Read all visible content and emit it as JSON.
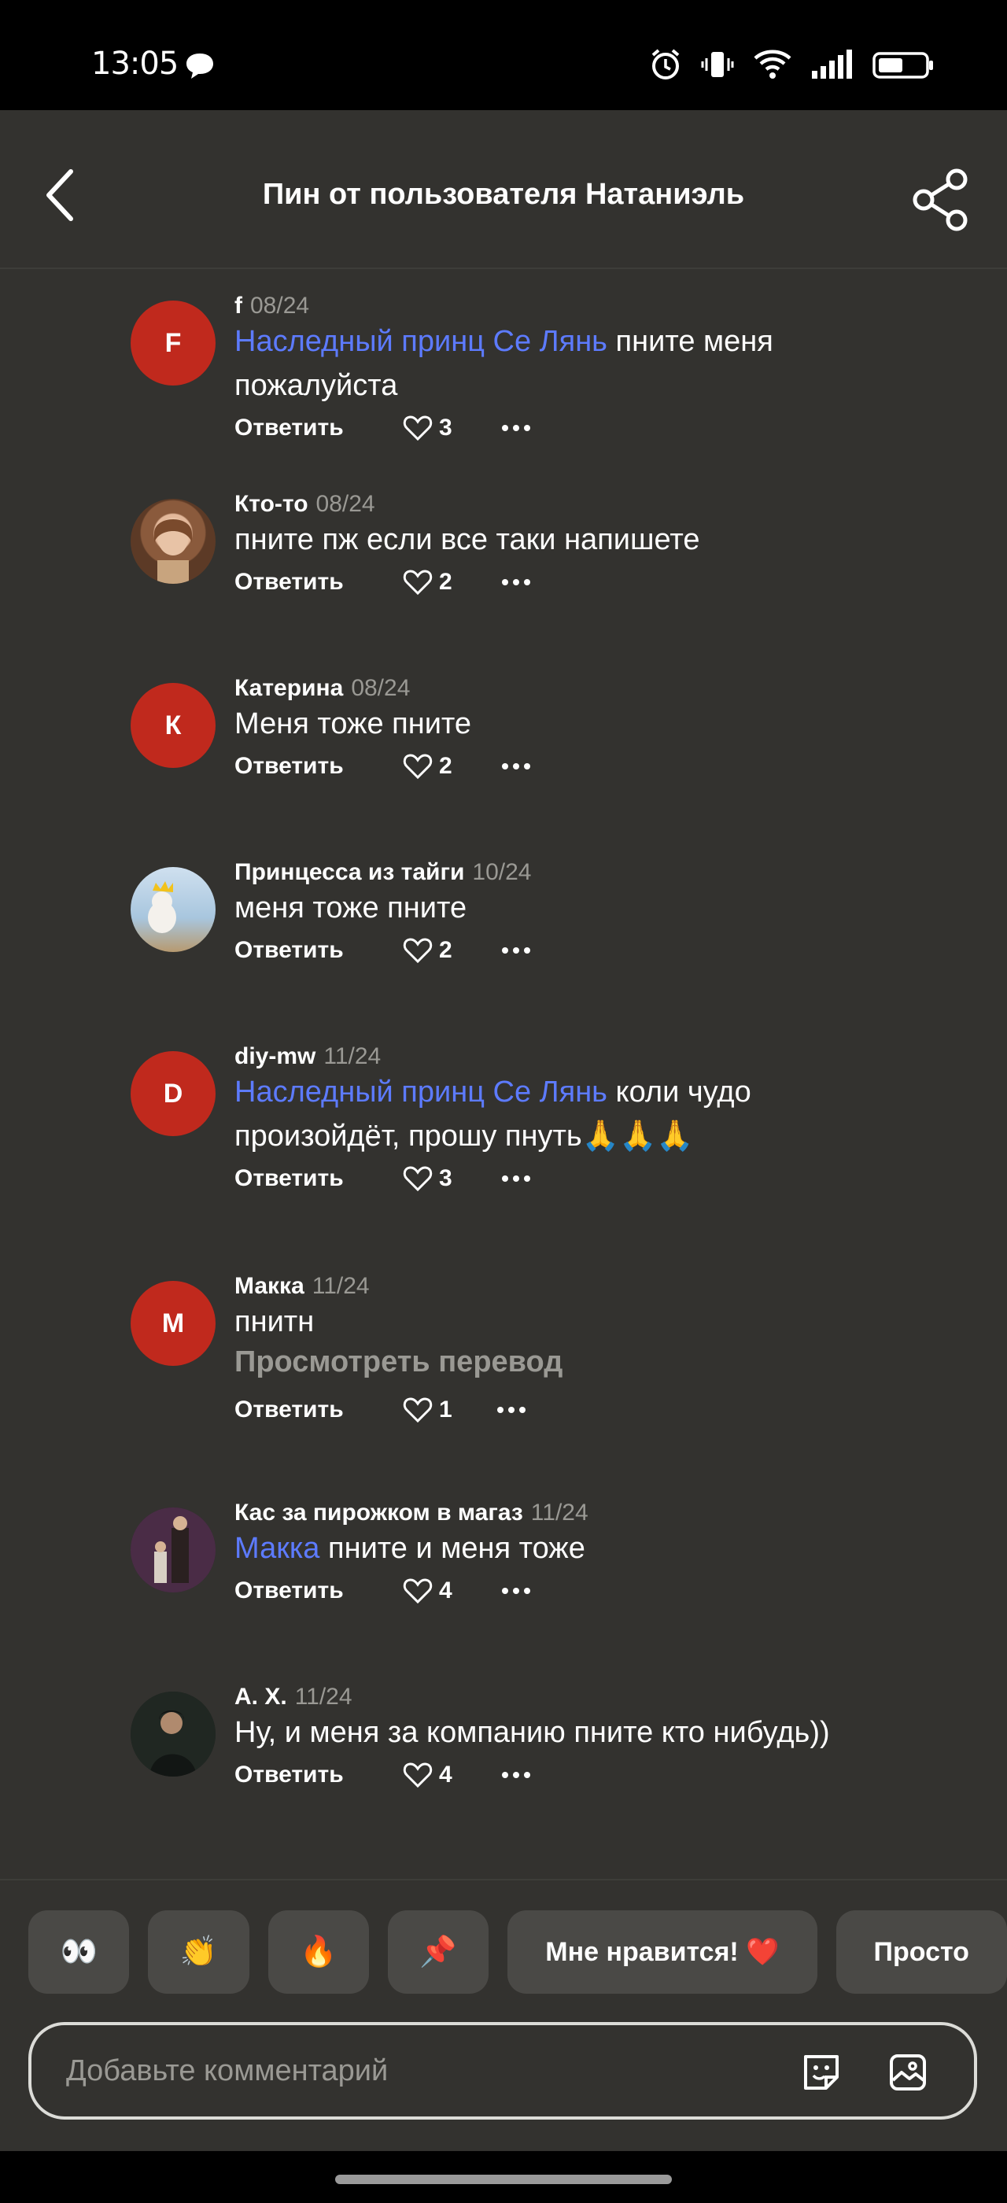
{
  "status_bar": {
    "time": "13:05"
  },
  "header": {
    "title": "Пин от пользователя Натаниэль"
  },
  "comments": [
    {
      "author": "f",
      "date": "08/24",
      "avatar_letter": "F",
      "mention": "Наследный принц Се Лянь",
      "text_line1": "пните меня",
      "text_line2": "пожалуйста",
      "reply": "Ответить",
      "likes": "3"
    },
    {
      "author": "Кто-то",
      "date": "08/24",
      "text": "пните пж если все таки напишете",
      "reply": "Ответить",
      "likes": "2"
    },
    {
      "author": "Катерина",
      "date": "08/24",
      "avatar_letter": "К",
      "text": "Меня тоже пните",
      "reply": "Ответить",
      "likes": "2"
    },
    {
      "author": "Принцесса из тайги",
      "date": "10/24",
      "text": "меня тоже пните",
      "reply": "Ответить",
      "likes": "2"
    },
    {
      "author": "diy-mw",
      "date": "11/24",
      "avatar_letter": "D",
      "mention": "Наследный принц Се Лянь",
      "text_line1": "коли чудо",
      "text_line2": "произойдёт, прошу пнуть🙏🙏🙏",
      "reply": "Ответить",
      "likes": "3"
    },
    {
      "author": "Макка",
      "date": "11/24",
      "avatar_letter": "M",
      "text": "пнитн",
      "translate": "Просмотреть перевод",
      "reply": "Ответить",
      "likes": "1"
    },
    {
      "author": "Кас за пирожком в магаз",
      "date": "11/24",
      "mention": "Макка",
      "text_line1": "пните и меня тоже",
      "reply": "Ответить",
      "likes": "4"
    },
    {
      "author": "А. Х.",
      "date": "11/24",
      "text": "Ну, и меня за компанию пните кто нибудь))",
      "reply": "Ответить",
      "likes": "4"
    }
  ],
  "reactions": [
    "👀",
    "👏",
    "🔥",
    "📌",
    "Мне нравится! ❤️",
    "Просто"
  ],
  "composer": {
    "placeholder": "Добавьте комментарий"
  },
  "colors": {
    "background": "#33322f",
    "mention": "#5d7bff",
    "avatar_red": "#c0291d",
    "muted": "#9a9994"
  }
}
